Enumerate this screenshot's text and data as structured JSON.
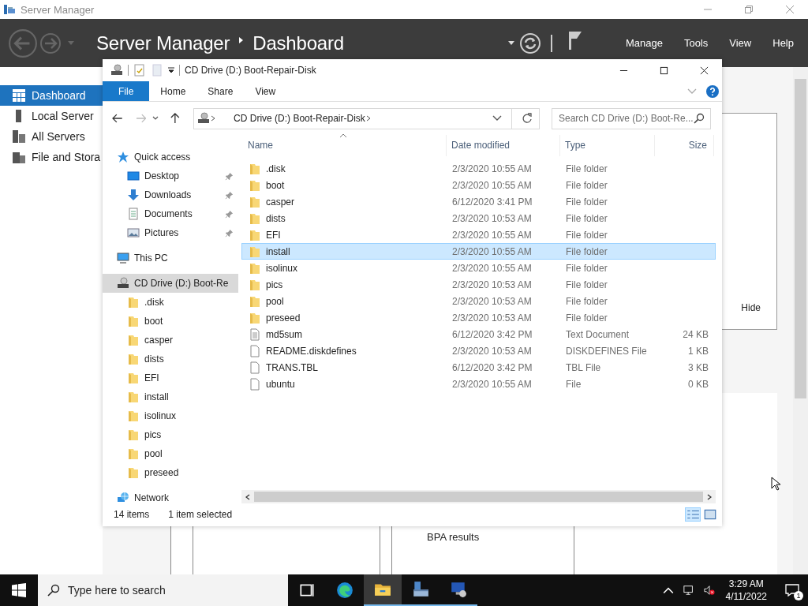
{
  "server_manager": {
    "title": "Server Manager",
    "breadcrumb": [
      "Server Manager",
      "Dashboard"
    ],
    "menu": [
      "Manage",
      "Tools",
      "View",
      "Help"
    ],
    "sidebar": [
      {
        "label": "Dashboard",
        "kind": "dashboard",
        "selected": true
      },
      {
        "label": "Local Server",
        "kind": "server",
        "selected": false
      },
      {
        "label": "All Servers",
        "kind": "servers",
        "selected": false
      },
      {
        "label": "File and Stora",
        "kind": "storage",
        "selected": false
      }
    ],
    "hide_label": "Hide",
    "bpa_title": "BPA results"
  },
  "explorer": {
    "title": "CD Drive (D:) Boot-Repair-Disk",
    "ribbon_tabs": [
      {
        "label": "File",
        "selected": true
      },
      {
        "label": "Home",
        "selected": false
      },
      {
        "label": "Share",
        "selected": false
      },
      {
        "label": "View",
        "selected": false
      }
    ],
    "address": "CD Drive (D:) Boot-Repair-Disk",
    "search": {
      "placeholder": "Search CD Drive (D:) Boot-Re..."
    },
    "nav": [
      {
        "label": "Quick access",
        "kind": "star",
        "selected": false,
        "children": [
          {
            "label": "Desktop",
            "kind": "desktop",
            "selected": false,
            "pinned": true
          },
          {
            "label": "Downloads",
            "kind": "download",
            "selected": false,
            "pinned": true
          },
          {
            "label": "Documents",
            "kind": "document",
            "selected": false,
            "pinned": true
          },
          {
            "label": "Pictures",
            "kind": "pictures",
            "selected": false,
            "pinned": true
          }
        ]
      },
      {
        "label": "This PC",
        "kind": "pc",
        "selected": false
      },
      {
        "label": "CD Drive (D:) Boot-Re",
        "kind": "cd",
        "selected": true,
        "children": [
          {
            "label": ".disk",
            "kind": "folder",
            "selected": false
          },
          {
            "label": "boot",
            "kind": "folder",
            "selected": false
          },
          {
            "label": "casper",
            "kind": "folder",
            "selected": false
          },
          {
            "label": "dists",
            "kind": "folder",
            "selected": false
          },
          {
            "label": "EFI",
            "kind": "folder",
            "selected": false
          },
          {
            "label": "install",
            "kind": "folder",
            "selected": false
          },
          {
            "label": "isolinux",
            "kind": "folder",
            "selected": false
          },
          {
            "label": "pics",
            "kind": "folder",
            "selected": false
          },
          {
            "label": "pool",
            "kind": "folder",
            "selected": false
          },
          {
            "label": "preseed",
            "kind": "folder",
            "selected": false
          }
        ]
      },
      {
        "label": "Network",
        "kind": "network",
        "selected": false
      }
    ],
    "columns": [
      "Name",
      "Date modified",
      "Type",
      "Size"
    ],
    "rows": [
      {
        "name": ".disk",
        "date": "2/3/2020 10:55 AM",
        "type": "File folder",
        "kind": "folder",
        "selected": false
      },
      {
        "name": "boot",
        "date": "2/3/2020 10:55 AM",
        "type": "File folder",
        "kind": "folder",
        "selected": false
      },
      {
        "name": "casper",
        "date": "6/12/2020 3:41 PM",
        "type": "File folder",
        "kind": "folder",
        "selected": false
      },
      {
        "name": "dists",
        "date": "2/3/2020 10:53 AM",
        "type": "File folder",
        "kind": "folder",
        "selected": false
      },
      {
        "name": "EFI",
        "date": "2/3/2020 10:55 AM",
        "type": "File folder",
        "kind": "folder",
        "selected": false
      },
      {
        "name": "install",
        "date": "2/3/2020 10:55 AM",
        "type": "File folder",
        "kind": "folder",
        "selected": true
      },
      {
        "name": "isolinux",
        "date": "2/3/2020 10:55 AM",
        "type": "File folder",
        "kind": "folder",
        "selected": false
      },
      {
        "name": "pics",
        "date": "2/3/2020 10:53 AM",
        "type": "File folder",
        "kind": "folder",
        "selected": false
      },
      {
        "name": "pool",
        "date": "2/3/2020 10:53 AM",
        "type": "File folder",
        "kind": "folder",
        "selected": false
      },
      {
        "name": "preseed",
        "date": "2/3/2020 10:53 AM",
        "type": "File folder",
        "kind": "folder",
        "selected": false
      },
      {
        "name": "md5sum",
        "date": "6/12/2020 3:42 PM",
        "type": "Text Document",
        "size": "24 KB",
        "kind": "text",
        "selected": false
      },
      {
        "name": "README.diskdefines",
        "date": "2/3/2020 10:53 AM",
        "type": "DISKDEFINES File",
        "size": "1 KB",
        "kind": "file",
        "selected": false
      },
      {
        "name": "TRANS.TBL",
        "date": "6/12/2020 3:42 PM",
        "type": "TBL File",
        "size": "3 KB",
        "kind": "file",
        "selected": false
      },
      {
        "name": "ubuntu",
        "date": "2/3/2020 10:55 AM",
        "type": "File",
        "size": "0 KB",
        "kind": "file",
        "selected": false
      }
    ],
    "status": {
      "count": "14 items",
      "selection": "1 item selected"
    }
  },
  "taskbar": {
    "search_placeholder": "Type here to search",
    "apps": [
      {
        "kind": "taskview",
        "selected": false,
        "running": false
      },
      {
        "kind": "edge",
        "selected": false,
        "running": false
      },
      {
        "kind": "explorer",
        "selected": true,
        "running": true
      },
      {
        "kind": "server",
        "selected": false,
        "running": true
      },
      {
        "kind": "monitor",
        "selected": false,
        "running": true
      }
    ],
    "time": "3:29 AM",
    "date": "4/11/2022",
    "notifications": "1"
  }
}
